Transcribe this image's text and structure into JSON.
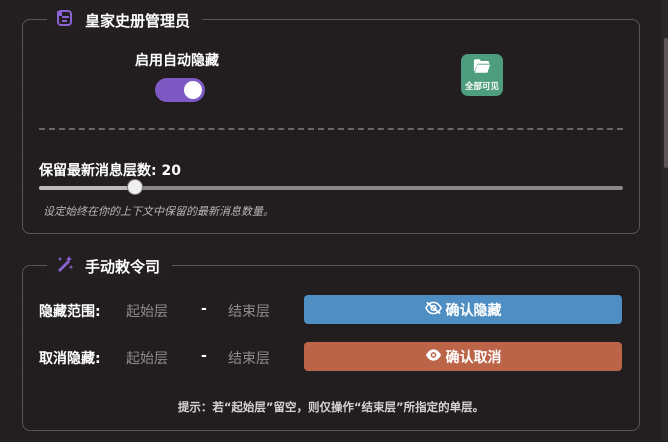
{
  "panel_archivist": {
    "title": "皇家史册管理员",
    "toggle_label": "启用自动隐藏",
    "toggle_on": true,
    "show_all_label": "全部可见",
    "keep_layers_label": "保留最新消息层数: 20",
    "keep_layers_value": 20,
    "slider_fraction": 0.165,
    "slider_desc": "设定始终在你的上下文中保留的最新消息数量。"
  },
  "panel_command": {
    "title": "手动敕令司",
    "hide_row_label": "隐藏范围:",
    "unhide_row_label": "取消隐藏:",
    "start_placeholder": "起始层",
    "end_placeholder": "结束层",
    "separator": "-",
    "confirm_hide_label": "确认隐藏",
    "confirm_unhide_label": "确认取消",
    "hint": "提示：若“起始层”留空，则仅操作“结束层”所指定的单层。"
  },
  "colors": {
    "background": "#231f20",
    "toggle": "#7e59c4",
    "show_all": "#4f9d7f",
    "hide_button": "#4e8ec3",
    "unhide_button": "#bb6448",
    "icon_accent": "#8a62d4"
  },
  "icons": {
    "archivist": "scroll-icon",
    "command": "magic-wand-icon",
    "show_all": "folder-open-icon",
    "hide": "eye-slash-icon",
    "unhide": "eye-icon"
  }
}
